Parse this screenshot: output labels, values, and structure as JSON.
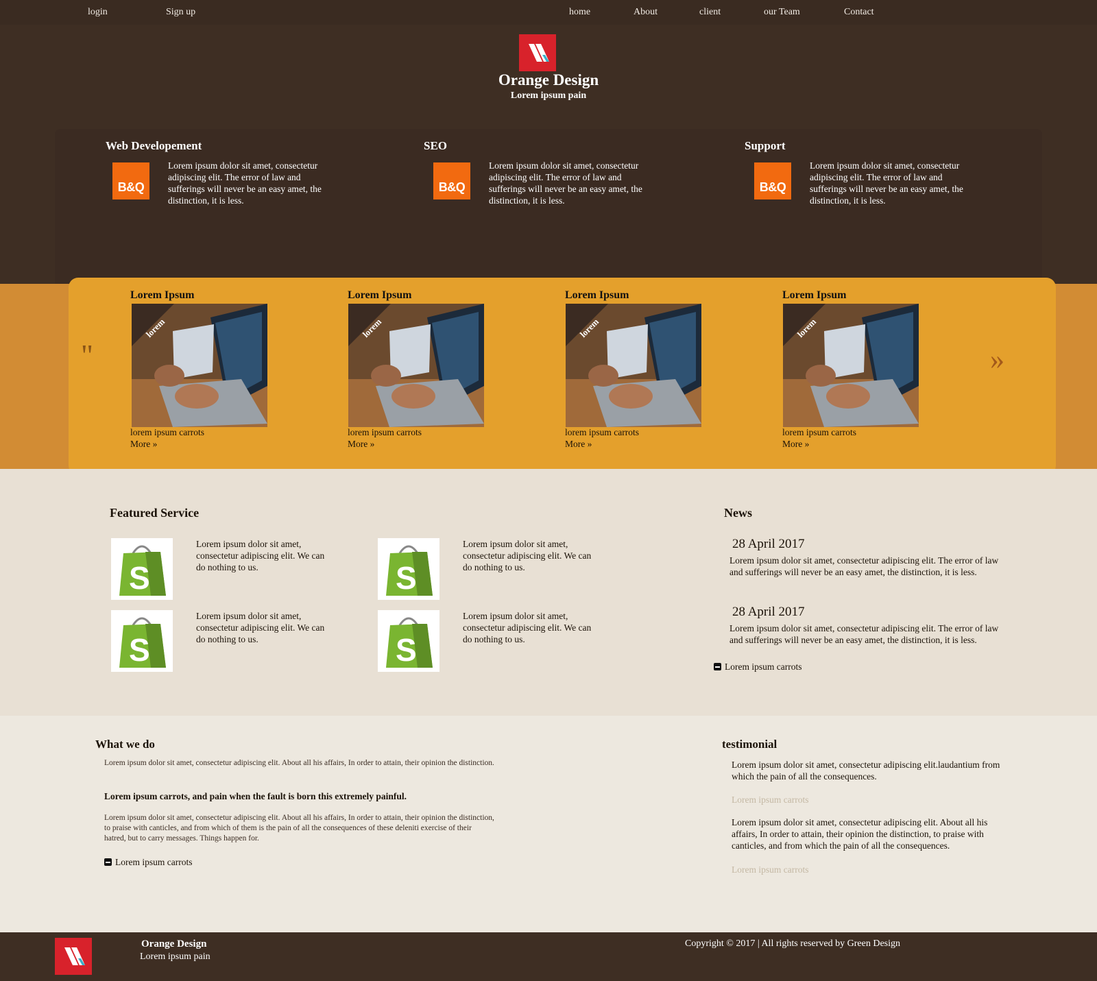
{
  "nav": {
    "left": [
      "login",
      "Sign up"
    ],
    "right": [
      "home",
      "About",
      "client",
      "our Team",
      "Contact"
    ]
  },
  "header": {
    "title": "Orange Design",
    "subtitle": "Lorem ipsum pain"
  },
  "services": [
    {
      "title": "Web Developement",
      "logo": "B&Q",
      "text": "Lorem ipsum dolor sit amet, consectetur adipiscing elit. The error of law and sufferings will never be an easy amet, the distinction, it is less."
    },
    {
      "title": "SEO",
      "logo": "B&Q",
      "text": "Lorem ipsum dolor sit amet, consectetur adipiscing elit. The error of law and sufferings will never be an easy amet, the distinction, it is less."
    },
    {
      "title": "Support",
      "logo": "B&Q",
      "text": "Lorem ipsum dolor sit amet, consectetur adipiscing elit. The error of law and sufferings will never be an easy amet, the distinction, it is less."
    }
  ],
  "slider": {
    "quote_mark": "\"",
    "next_arrow": "»",
    "items": [
      {
        "title": "Lorem Ipsum",
        "ribbon": "lorem",
        "caption": "lorem ipsum carrots",
        "more": "More »"
      },
      {
        "title": "Lorem Ipsum",
        "ribbon": "lorem",
        "caption": "lorem ipsum carrots",
        "more": "More »"
      },
      {
        "title": "Lorem Ipsum",
        "ribbon": "lorem",
        "caption": "lorem ipsum carrots",
        "more": "More »"
      },
      {
        "title": "Lorem Ipsum",
        "ribbon": "lorem",
        "caption": "lorem ipsum carrots",
        "more": "More »"
      }
    ]
  },
  "featured": {
    "heading": "Featured Service",
    "items": [
      {
        "text": "Lorem ipsum dolor sit amet, consectetur adipiscing elit. We can do nothing to us."
      },
      {
        "text": "Lorem ipsum dolor sit amet, consectetur adipiscing elit. We can do nothing to us."
      },
      {
        "text": "Lorem ipsum dolor sit amet, consectetur adipiscing elit. We can do nothing to us."
      },
      {
        "text": "Lorem ipsum dolor sit amet, consectetur adipiscing elit. We can do nothing to us."
      }
    ]
  },
  "news": {
    "heading": "News",
    "items": [
      {
        "date": "28 April 2017",
        "text": "Lorem ipsum dolor sit amet, consectetur adipiscing elit. The error of law and sufferings will never be an easy amet, the distinction, it is less."
      },
      {
        "date": "28 April 2017",
        "text": "Lorem ipsum dolor sit amet, consectetur adipiscing elit. The error of law and sufferings will never be an easy amet, the distinction, it is less."
      }
    ],
    "link": "Lorem ipsum carrots"
  },
  "what_we_do": {
    "heading": "What we do",
    "para1": "Lorem ipsum dolor sit amet, consectetur adipiscing elit. About all his affairs, In order to attain, their opinion the distinction.",
    "bold": "Lorem ipsum carrots, and pain when the fault is born this extremely painful.",
    "para2": "Lorem ipsum dolor sit amet, consectetur adipiscing elit. About all his affairs, In order to attain, their opinion the distinction, to praise with canticles, and from which of them is the pain of all the consequences of these deleniti exercise of their hatred, but to carry messages. Things happen for.",
    "link": "Lorem ipsum carrots"
  },
  "testimonial": {
    "heading": "testimonial",
    "quote1": "Lorem ipsum dolor sit amet, consectetur adipiscing elit.laudantium from which the pain of all the consequences.",
    "author1": "Lorem ipsum carrots",
    "quote2": "Lorem ipsum dolor sit amet, consectetur adipiscing elit. About all his affairs, In order to attain, their opinion the distinction, to praise with canticles, and from which the pain of all the consequences.",
    "author2": "Lorem ipsum carrots"
  },
  "footer": {
    "title": "Orange Design",
    "subtitle": "Lorem ipsum pain",
    "copyright": "Copyright © 2017 | All rights reserved by Green Design"
  },
  "colors": {
    "brown_dark": "#3e2e23",
    "orange_panel": "#e4a02c",
    "orange_band": "#d28c34",
    "logo_red": "#d8222b",
    "bq_orange": "#f26a10",
    "beige": "#e8e0d4"
  }
}
